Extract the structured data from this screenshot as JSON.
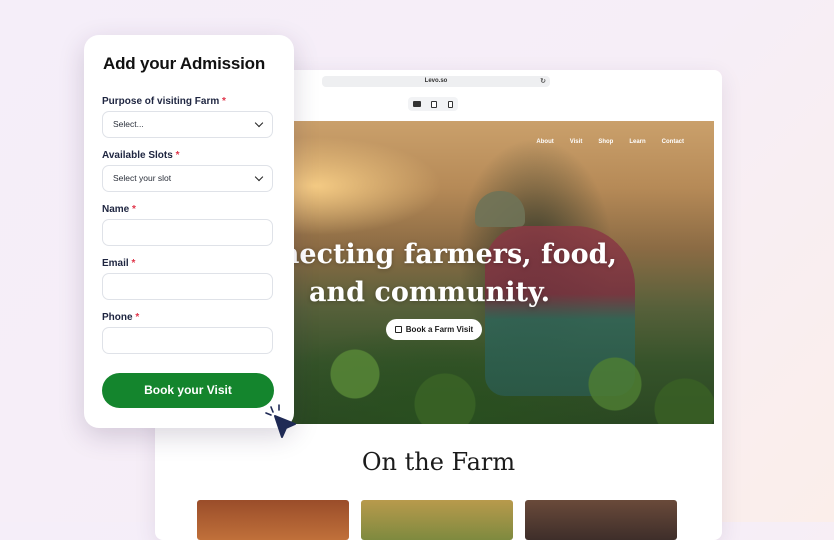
{
  "browser": {
    "url": "Levo.so",
    "nav": [
      "About",
      "Visit",
      "Shop",
      "Learn",
      "Contact"
    ],
    "hero_title_line1": "onnecting farmers, food,",
    "hero_title_line2": "and community.",
    "hero_button": "Book a Farm Visit",
    "section_title": "On the Farm"
  },
  "form": {
    "title": "Add your Admission",
    "required_marker": "*",
    "fields": [
      {
        "label": "Purpose of visiting Farm",
        "value": "Select..."
      },
      {
        "label": "Available Slots",
        "value": "Select your slot"
      },
      {
        "label": "Name",
        "value": ""
      },
      {
        "label": "Email",
        "value": ""
      },
      {
        "label": "Phone",
        "value": ""
      }
    ],
    "submit_label": "Book your Visit"
  },
  "colors": {
    "accent_green": "#14852d",
    "required_red": "#e0354a",
    "cursor_navy": "#1f2a55"
  }
}
